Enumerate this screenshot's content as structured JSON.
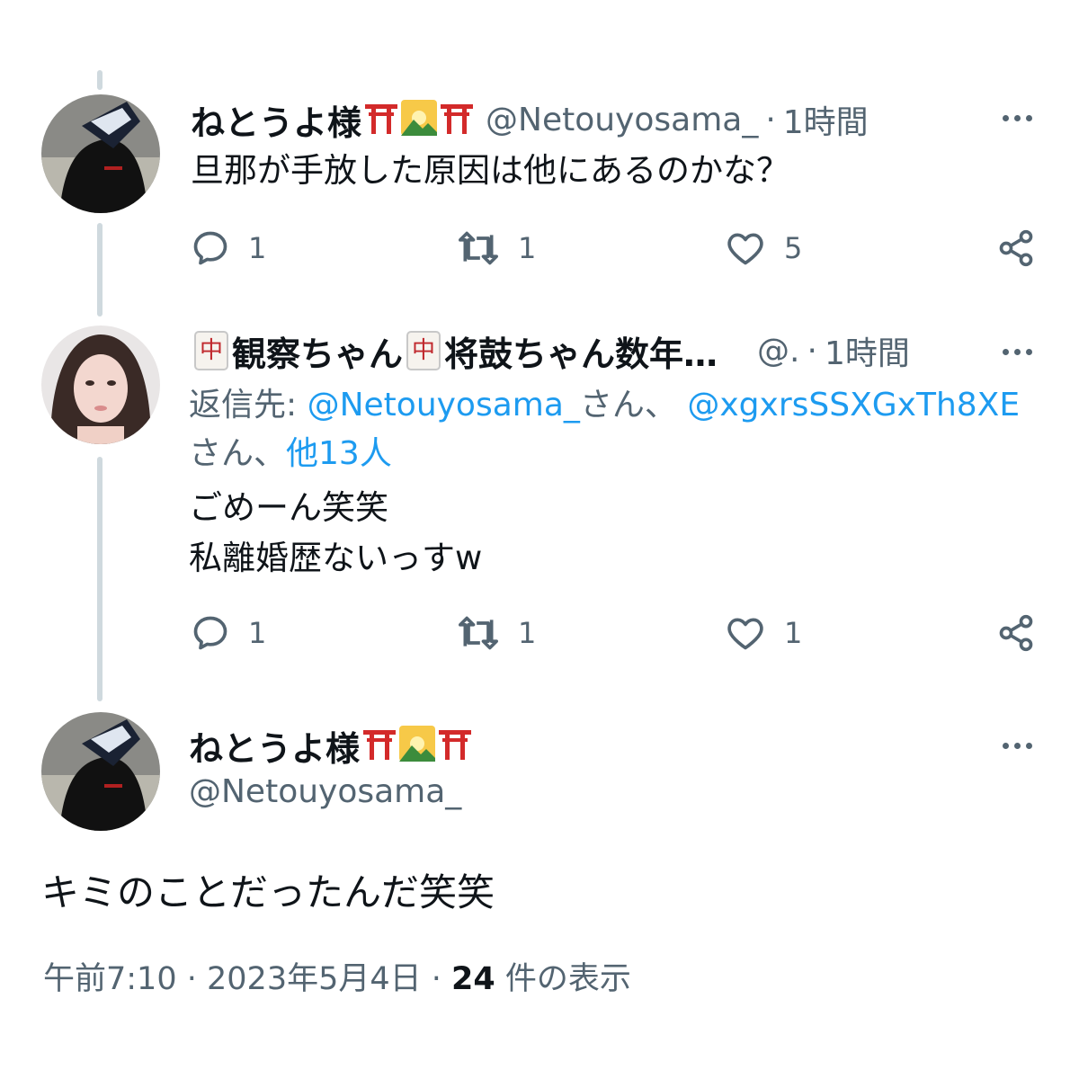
{
  "tweet1": {
    "name": "ねとうよ様",
    "handle": "@Netouyosama_",
    "time": "1時間",
    "text": "旦那が手放した原因は他にあるのかな？",
    "reply_count": "1",
    "retweet_count": "1",
    "like_count": "5"
  },
  "tweet2": {
    "tile_char": "中",
    "name_part1": "観察ちゃん",
    "name_part2": "将鼓ちゃん数年…",
    "handle": "@.",
    "time": "1時間",
    "reply_to_label": "返信先:",
    "reply_to_user1": "@Netouyosama_",
    "reply_to_san1": "さん、",
    "reply_to_user2": "@xgxrsSSXGxTh8XE",
    "reply_to_san2": "さん、",
    "reply_to_others": "他13人",
    "text_line1": "ごめーん笑笑",
    "text_line2": "私離婚歴ないっすw",
    "reply_count": "1",
    "retweet_count": "1",
    "like_count": "1"
  },
  "main_tweet": {
    "name": "ねとうよ様",
    "handle": "@Netouyosama_",
    "text": "キミのことだったんだ笑笑",
    "time": "午前7:10",
    "date": "2023年5月4日",
    "view_count": "24",
    "view_label": "件の表示"
  },
  "icons": [
    "torii-icon",
    "sunrise-over-mountains-icon",
    "reply-icon",
    "retweet-icon",
    "like-icon",
    "share-icon",
    "more-icon"
  ],
  "colors": {
    "text": "#0f1419",
    "secondary": "#536471",
    "link": "#1d9bf0",
    "thread_line": "#cfd9de"
  }
}
